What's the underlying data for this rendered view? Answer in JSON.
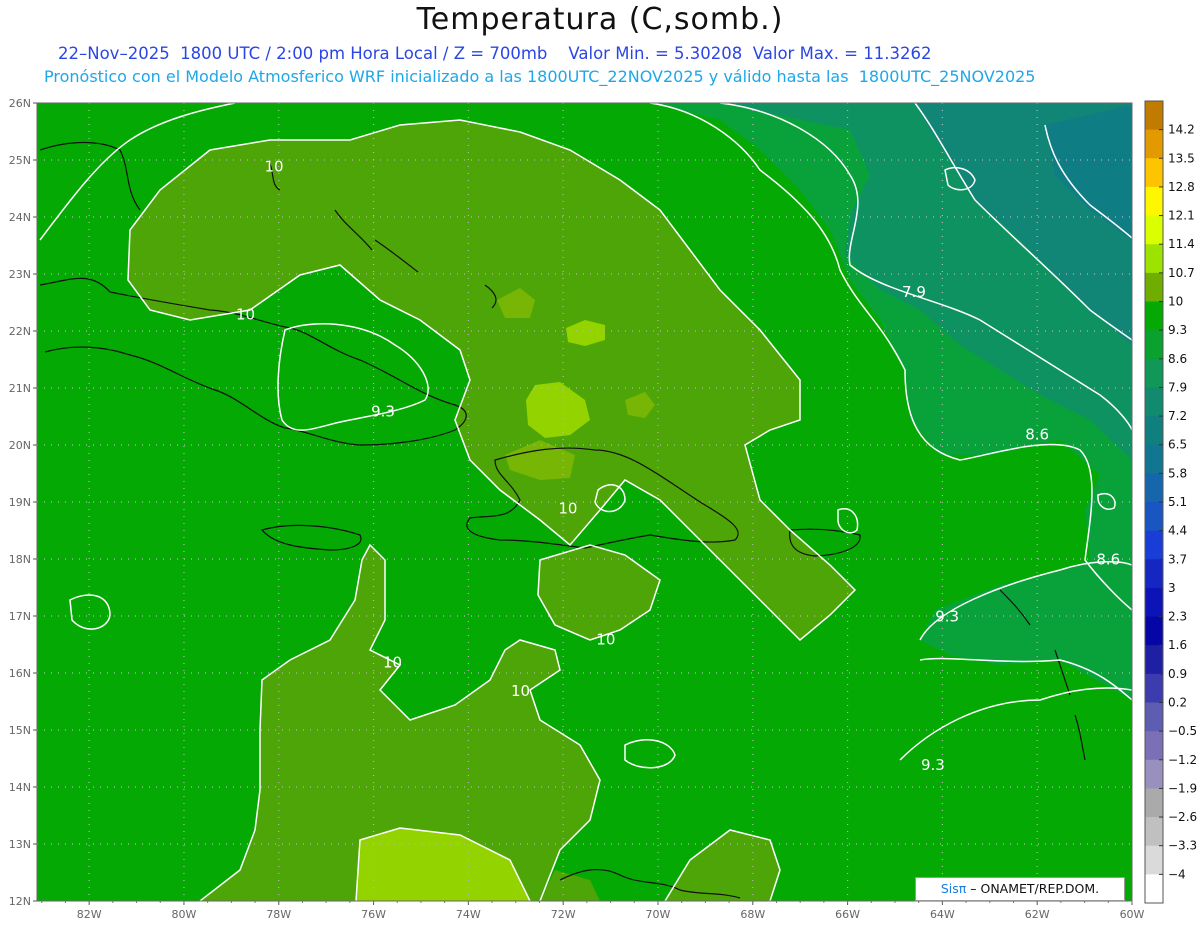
{
  "title": "Temperatura (C,somb.)",
  "subtitle_date": "22–Nov–2025  1800 UTC / 2:00 pm Hora Local / Z = 700mb",
  "subtitle_minmax": "Valor Min. = 5.30208  Valor Max. = 11.3262",
  "subtitle_model": "Pronóstico con el Modelo Atmosferico WRF inicializado a las 1800UTC_22NOV2025 y válido hasta las  1800UTC_25NOV2025",
  "credit": {
    "brand": "Sisπ",
    "rest": " – ONAMET/REP.DOM."
  },
  "colors": {
    "c93": "#04a904",
    "c86": "#09a23a",
    "c79": "#0e9262",
    "c72": "#118676",
    "c10": "#4ea508",
    "c107": "#77b604",
    "c114": "#93d300",
    "contour": "#ffffff",
    "grid": "#b6b6b6",
    "coast": "#111111"
  },
  "latitude_labels": [
    "26N",
    "25N",
    "24N",
    "23N",
    "22N",
    "21N",
    "20N",
    "19N",
    "18N",
    "17N",
    "16N",
    "15N",
    "14N",
    "13N",
    "12N"
  ],
  "longitude_labels": [
    "82W",
    "80W",
    "78W",
    "76W",
    "74W",
    "72W",
    "70W",
    "68W",
    "66W",
    "64W",
    "62W",
    "60W"
  ],
  "contour_labels": [
    {
      "text": "10",
      "lon": -78.1,
      "lat": 24.8
    },
    {
      "text": "10",
      "lon": -78.7,
      "lat": 22.2
    },
    {
      "text": "9.3",
      "lon": -75.8,
      "lat": 20.5
    },
    {
      "text": "7.9",
      "lon": -64.6,
      "lat": 22.6
    },
    {
      "text": "8.6",
      "lon": -62.0,
      "lat": 20.1
    },
    {
      "text": "10",
      "lon": -71.9,
      "lat": 18.8
    },
    {
      "text": "8.6",
      "lon": -60.5,
      "lat": 17.9
    },
    {
      "text": "9.3",
      "lon": -63.9,
      "lat": 16.9
    },
    {
      "text": "10",
      "lon": -71.1,
      "lat": 16.5
    },
    {
      "text": "10",
      "lon": -75.6,
      "lat": 16.1
    },
    {
      "text": "10",
      "lon": -72.9,
      "lat": 15.6
    },
    {
      "text": "9.3",
      "lon": -64.2,
      "lat": 14.3
    }
  ],
  "colorbar": {
    "labels": [
      "14.2",
      "13.5",
      "12.8",
      "12.1",
      "11.4",
      "10.7",
      "10",
      "9.3",
      "8.6",
      "7.9",
      "7.2",
      "6.5",
      "5.8",
      "5.1",
      "4.4",
      "3.7",
      "3",
      "2.3",
      "1.6",
      "0.9",
      "0.2",
      "−0.5",
      "−1.2",
      "−1.9",
      "−2.6",
      "−3.3",
      "−4"
    ],
    "colors": [
      "#c17b00",
      "#e39a00",
      "#ffc400",
      "#fff700",
      "#d9ff00",
      "#9ee300",
      "#6fae00",
      "#04a904",
      "#0aa12e",
      "#0f9858",
      "#118a6e",
      "#10807f",
      "#117690",
      "#1666ab",
      "#1956c1",
      "#193ed7",
      "#1527c0",
      "#0c14b8",
      "#0606a6",
      "#1f1fa4",
      "#3c3cae",
      "#5d5db2",
      "#7b6fb6",
      "#9990c0",
      "#aaaaaa",
      "#c0c0c0",
      "#dadada",
      "#ffffff"
    ]
  }
}
